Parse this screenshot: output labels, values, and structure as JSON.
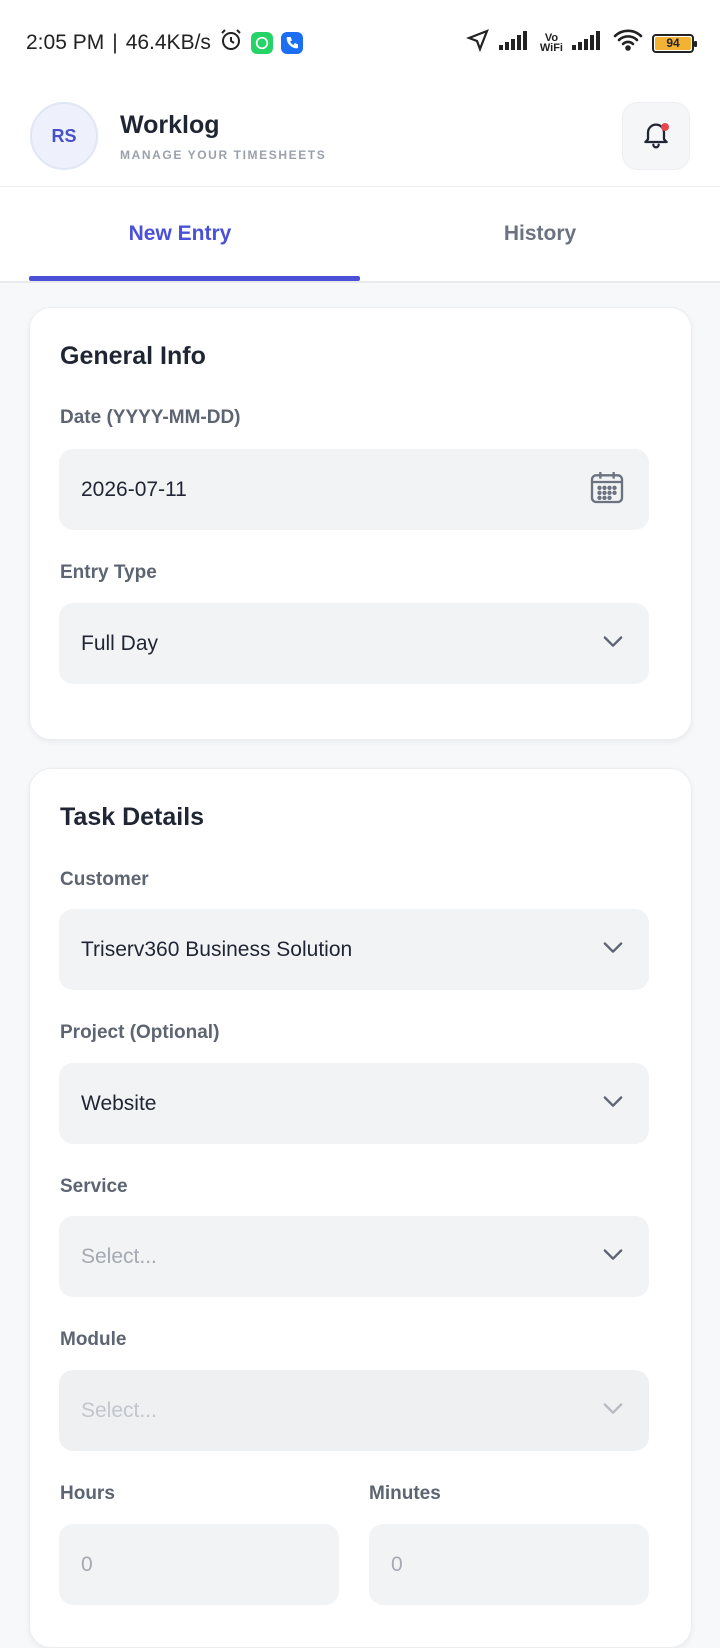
{
  "status": {
    "time": "2:05 PM",
    "speed": "46.4KB/s",
    "battery": "94",
    "vowifi_top": "Vo",
    "vowifi_bottom": "WiFi"
  },
  "header": {
    "avatar_initials": "RS",
    "title": "Worklog",
    "subtitle": "MANAGE YOUR TIMESHEETS"
  },
  "tabs": [
    {
      "label": "New Entry",
      "active": true
    },
    {
      "label": "History",
      "active": false
    }
  ],
  "general_info": {
    "title": "General Info",
    "date_label": "Date (YYYY-MM-DD)",
    "date_value": "2026-07-11",
    "entry_type_label": "Entry Type",
    "entry_type_value": "Full Day"
  },
  "task_details": {
    "title": "Task Details",
    "customer_label": "Customer",
    "customer_value": "Triserv360 Business Solution",
    "project_label": "Project (Optional)",
    "project_value": "Website",
    "service_label": "Service",
    "service_placeholder": "Select...",
    "module_label": "Module",
    "module_placeholder": "Select...",
    "hours_label": "Hours",
    "hours_value": "0",
    "minutes_label": "Minutes",
    "minutes_value": "0"
  },
  "colors": {
    "accent": "#4a51d6",
    "notification_dot": "#e5484d",
    "whatsapp": "#25d366",
    "app_blue": "#1c6ef2"
  },
  "icons": [
    "navigation-icon",
    "alarm-icon",
    "whatsapp-icon",
    "phone-app-icon",
    "signal-icon",
    "wifi-icon",
    "battery-icon",
    "bell-icon",
    "calendar-icon",
    "chevron-down-icon"
  ]
}
